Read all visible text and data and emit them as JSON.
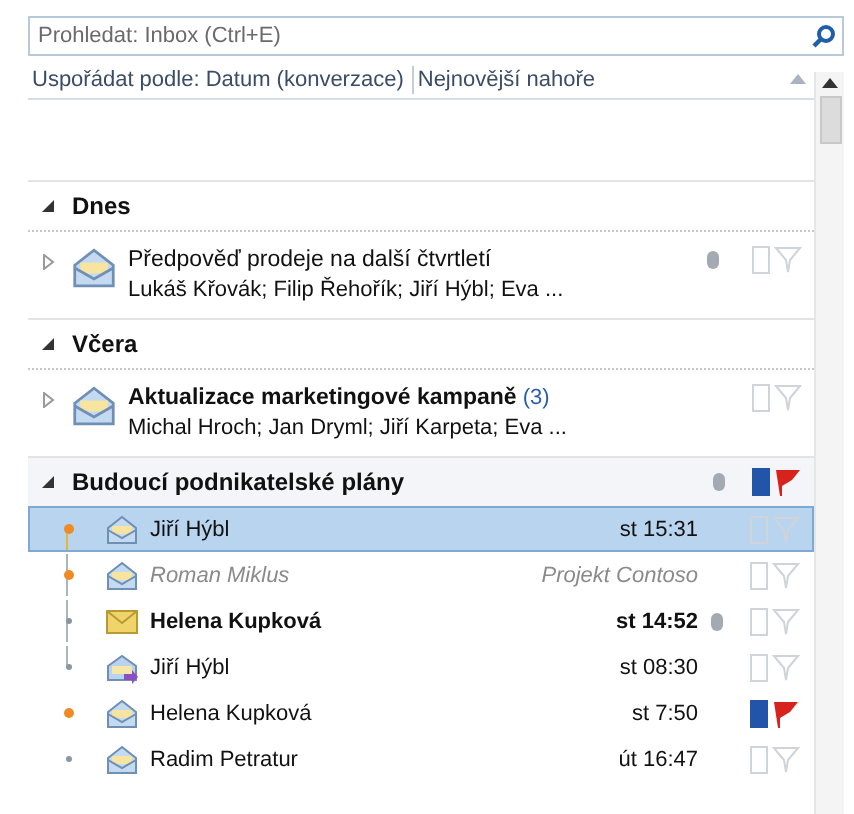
{
  "search": {
    "placeholder": "Prohledat: Inbox (Ctrl+E)"
  },
  "sort": {
    "by": "Uspořádat podle: Datum (konverzace)",
    "order": "Nejnovější nahoře"
  },
  "groups": [
    {
      "label": "Dnes",
      "expanded": true,
      "items": [
        {
          "kind": "thread",
          "expanded": false,
          "subject": "Předpověď prodeje na další čtvrtletí",
          "people": "Lukáš Křovák; Filip Řehořík; Jiří Hýbl; Eva ...",
          "unread": false,
          "attachment": true,
          "categorized": false,
          "flagged": false
        }
      ]
    },
    {
      "label": "Včera",
      "expanded": true,
      "items": [
        {
          "kind": "thread",
          "expanded": false,
          "subject": "Aktualizace marketingové kampaně",
          "count": "(3)",
          "people": "Michal Hroch; Jan Dryml; Jiří Karpeta; Eva ...",
          "unread": true,
          "attachment": false,
          "categorized": false,
          "flagged": false
        }
      ]
    },
    {
      "label": "Budoucí podnikatelské plány",
      "expanded": true,
      "attachment": true,
      "categorized": true,
      "flagged": true,
      "items": [
        {
          "kind": "message",
          "sender": "Jiří Hýbl",
          "time": "st 15:31",
          "forwarded": false,
          "selected": true,
          "unread": false,
          "new": true,
          "other_folder": false,
          "attachment": false,
          "categorized": false,
          "flagged": false
        },
        {
          "kind": "message",
          "sender": "Roman Miklus",
          "time": "Projekt Contoso",
          "forwarded": false,
          "selected": false,
          "unread": false,
          "new": true,
          "other_folder": true,
          "attachment": false,
          "categorized": false,
          "flagged": false
        },
        {
          "kind": "message",
          "sender": "Helena Kupková",
          "time": "st 14:52",
          "forwarded": false,
          "selected": false,
          "unread": true,
          "new": false,
          "other_folder": false,
          "attachment": true,
          "categorized": false,
          "flagged": false
        },
        {
          "kind": "message",
          "sender": "Jiří Hýbl",
          "time": "st 08:30",
          "forwarded": true,
          "selected": false,
          "unread": false,
          "new": false,
          "other_folder": false,
          "attachment": false,
          "categorized": false,
          "flagged": false
        },
        {
          "kind": "message",
          "sender": "Helena Kupková",
          "time": "st 7:50",
          "forwarded": false,
          "selected": false,
          "unread": false,
          "new": true,
          "other_folder": false,
          "attachment": false,
          "categorized": true,
          "flagged": true
        },
        {
          "kind": "message",
          "sender": "Radim Petratur",
          "time": "út 16:47",
          "forwarded": false,
          "selected": false,
          "unread": false,
          "new": false,
          "other_folder": false,
          "attachment": false,
          "categorized": false,
          "flagged": false
        }
      ]
    }
  ]
}
